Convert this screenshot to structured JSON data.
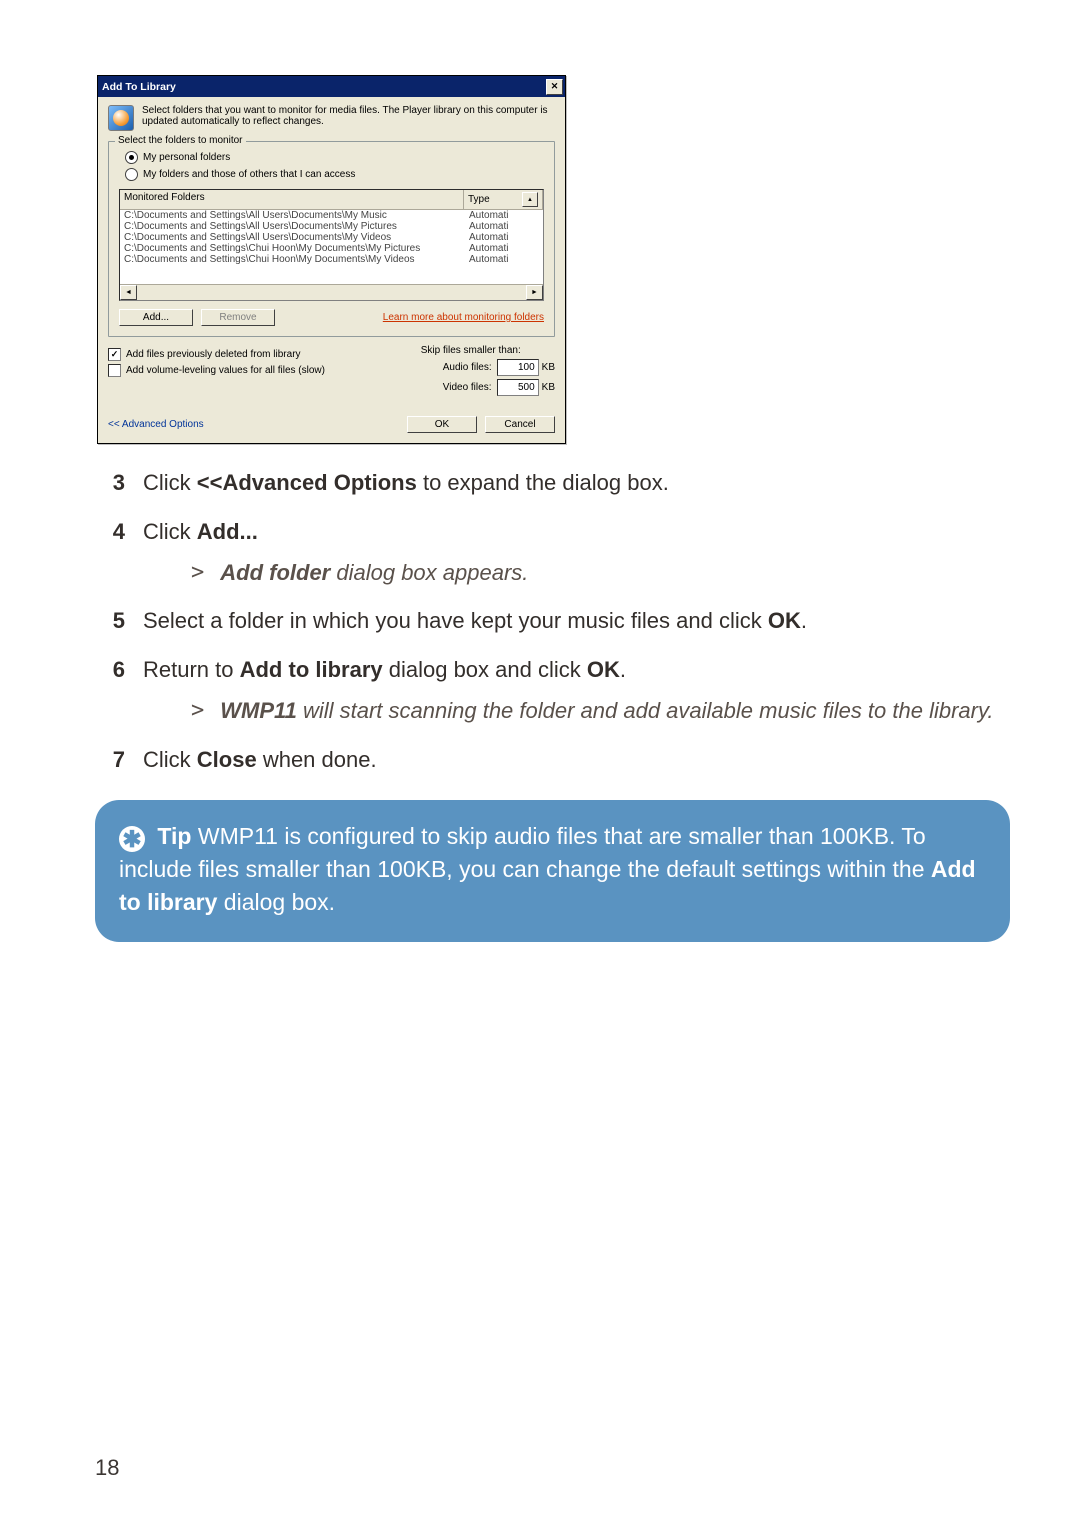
{
  "dialog": {
    "title": "Add To Library",
    "intro": "Select folders that you want to monitor for media files. The Player library on this computer is updated automatically to reflect changes.",
    "fieldsetLegend": "Select the folders to monitor",
    "radios": {
      "personal": "My personal folders",
      "others": "My folders and those of others that I can access"
    },
    "columns": {
      "path": "Monitored Folders",
      "type": "Type"
    },
    "rows": [
      {
        "path": "C:\\Documents and Settings\\All Users\\Documents\\My Music",
        "type": "Automati"
      },
      {
        "path": "C:\\Documents and Settings\\All Users\\Documents\\My Pictures",
        "type": "Automati"
      },
      {
        "path": "C:\\Documents and Settings\\All Users\\Documents\\My Videos",
        "type": "Automati"
      },
      {
        "path": "C:\\Documents and Settings\\Chui Hoon\\My Documents\\My Pictures",
        "type": "Automati"
      },
      {
        "path": "C:\\Documents and Settings\\Chui Hoon\\My Documents\\My Videos",
        "type": "Automati"
      }
    ],
    "addBtn": "Add...",
    "removeBtn": "Remove",
    "learnMore": "Learn more about monitoring folders",
    "checks": {
      "addPrev": "Add files previously deleted from library",
      "volLevel": "Add volume-leveling values for all files (slow)"
    },
    "skip": {
      "title": "Skip files smaller than:",
      "audioLabel": "Audio files:",
      "audioVal": "100",
      "videoLabel": "Video files:",
      "videoVal": "500",
      "kb": "KB"
    },
    "advanced": "<< Advanced Options",
    "ok": "OK",
    "cancel": "Cancel"
  },
  "steps": {
    "s3": {
      "num": "3",
      "pre": "Click ",
      "bold": "<<Advanced Options",
      "post": " to expand the dialog box."
    },
    "s4": {
      "num": "4",
      "pre": "Click ",
      "bold": "Add..."
    },
    "s4sub": {
      "bold": "Add folder",
      "rest": " dialog box appears."
    },
    "s5": {
      "num": "5",
      "pre": "Select a folder in which you have kept your music files and click ",
      "bold": "OK",
      "post": "."
    },
    "s6": {
      "num": "6",
      "pre": "Return to ",
      "bold": "Add to library",
      "mid": " dialog box and click ",
      "bold2": "OK",
      "post": "."
    },
    "s6sub": {
      "bold": "WMP11",
      "rest": " will start scanning the folder and add available music files to the library."
    },
    "s7": {
      "num": "7",
      "pre": "Click ",
      "bold": "Close",
      "post": " when done."
    }
  },
  "tip": {
    "label": "Tip",
    "text1": " WMP11 is configured to skip audio files that are smaller than 100KB. To include files smaller than 100KB, you can change the default settings within the ",
    "bold": "Add to library",
    "text2": " dialog box."
  },
  "pageNumber": "18"
}
